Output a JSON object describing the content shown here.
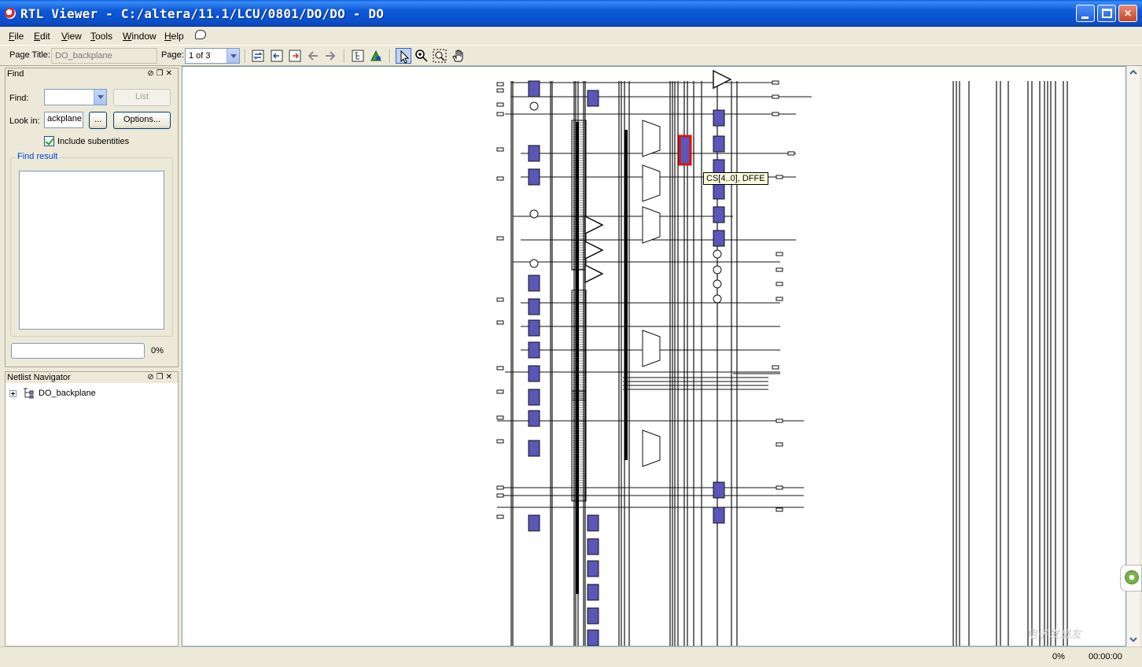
{
  "window": {
    "title": "RTL Viewer - C:/altera/11.1/LCU/0801/DO/DO - DO"
  },
  "menu": [
    "File",
    "Edit",
    "View",
    "Tools",
    "Window",
    "Help"
  ],
  "toolbar": {
    "page_title_label": "Page Title:",
    "page_title_value": "DO_backplane",
    "page_label": "Page:",
    "page_value": "1 of 3"
  },
  "find_panel": {
    "title": "Find",
    "find_label": "Find:",
    "find_value": "",
    "list_button": "List",
    "look_in_label": "Look in:",
    "look_in_value": "ackplane",
    "browse_button": "...",
    "options_button": "Options...",
    "include_subentities_label": "Include subentities",
    "include_subentities_checked": true,
    "find_result_title": "Find result",
    "progress_percent": "0%",
    "progress_value": 0
  },
  "netlist_navigator": {
    "title": "Netlist Navigator",
    "root_item": "DO_backplane"
  },
  "canvas": {
    "tooltip": "CS[4..0], DFFE"
  },
  "status": {
    "percent": "0%",
    "time": "00:00:00"
  },
  "watermark": "电子发烧友"
}
